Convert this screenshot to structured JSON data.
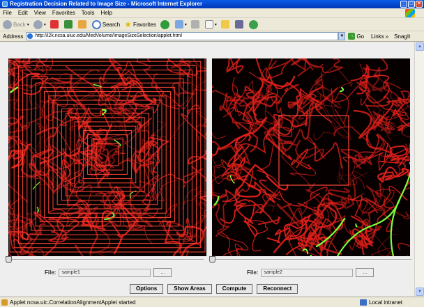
{
  "window": {
    "title": "Registration Decision Related to Image Size - Microsoft Internet Explorer"
  },
  "menu": [
    "File",
    "Edit",
    "View",
    "Favorites",
    "Tools",
    "Help"
  ],
  "toolbar": {
    "back": "Back",
    "search": "Search",
    "favorites": "Favorites"
  },
  "address": {
    "label": "Address",
    "url": "http://i2k.ncsa.uiuc.edu/MedVolume/ImageSizeSelection/applet.html",
    "go": "Go",
    "links": "Links",
    "snagit": "SnagIt"
  },
  "panels": {
    "left": {
      "file_label": "File:",
      "file_value": "sample1",
      "browse": "...",
      "slider_value": 0
    },
    "right": {
      "file_label": "File:",
      "file_value": "sample2",
      "browse": "...",
      "slider_value": 0
    }
  },
  "buttons": {
    "options": "Options",
    "show_areas": "Show Areas",
    "compute": "Compute",
    "reconnect": "Reconnect"
  },
  "status": {
    "text": "Applet ncsa.uic.CorrelationAlignmentApplet started",
    "zone": "Local intranet"
  },
  "colors": {
    "vessel": "#e0201a",
    "highlight": "#7cff3a",
    "overlay": "#ff3b30",
    "xp_blue": "#0a5ae8"
  }
}
